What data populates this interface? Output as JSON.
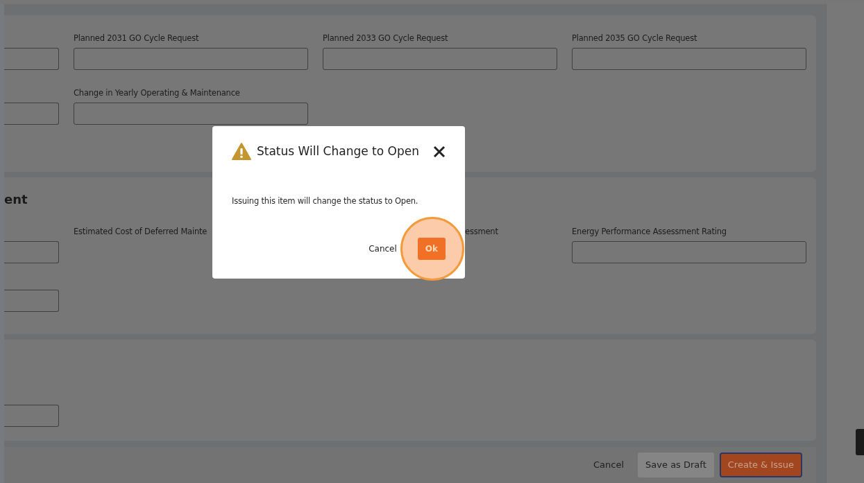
{
  "sections": [
    {
      "rows": [
        [
          {
            "kind": "input"
          },
          {
            "kind": "labeled_input",
            "label": "Planned 2031 GO Cycle Request"
          },
          {
            "kind": "labeled_input",
            "label": "Planned 2033 GO Cycle Request"
          },
          {
            "kind": "labeled_input",
            "label": "Planned 2035 GO Cycle Request"
          }
        ],
        [
          {
            "kind": "input"
          },
          {
            "kind": "labeled_input",
            "label": "Change in Yearly Operating & Maintenance"
          }
        ]
      ]
    },
    {
      "heading": "ent",
      "rows": [
        [
          {
            "kind": "input"
          },
          {
            "kind": "label_only",
            "label": "Estimated Cost of Deferred Mainte"
          },
          {
            "kind": "label_tail",
            "label": "essment"
          },
          {
            "kind": "labeled_input",
            "label": "Energy Performance Assessment Rating"
          }
        ],
        [
          {
            "kind": "input"
          }
        ]
      ]
    },
    {
      "rows": [
        [
          {
            "kind": "input"
          }
        ]
      ]
    }
  ],
  "footer": {
    "cancel": "Cancel",
    "save_draft": "Save as Draft",
    "create_issue": "Create & Issue"
  },
  "dialog": {
    "title": "Status Will Change to Open",
    "message": "Issuing this item will change the status to Open.",
    "cancel": "Cancel",
    "ok": "Ok",
    "ok_highlighted": true
  }
}
